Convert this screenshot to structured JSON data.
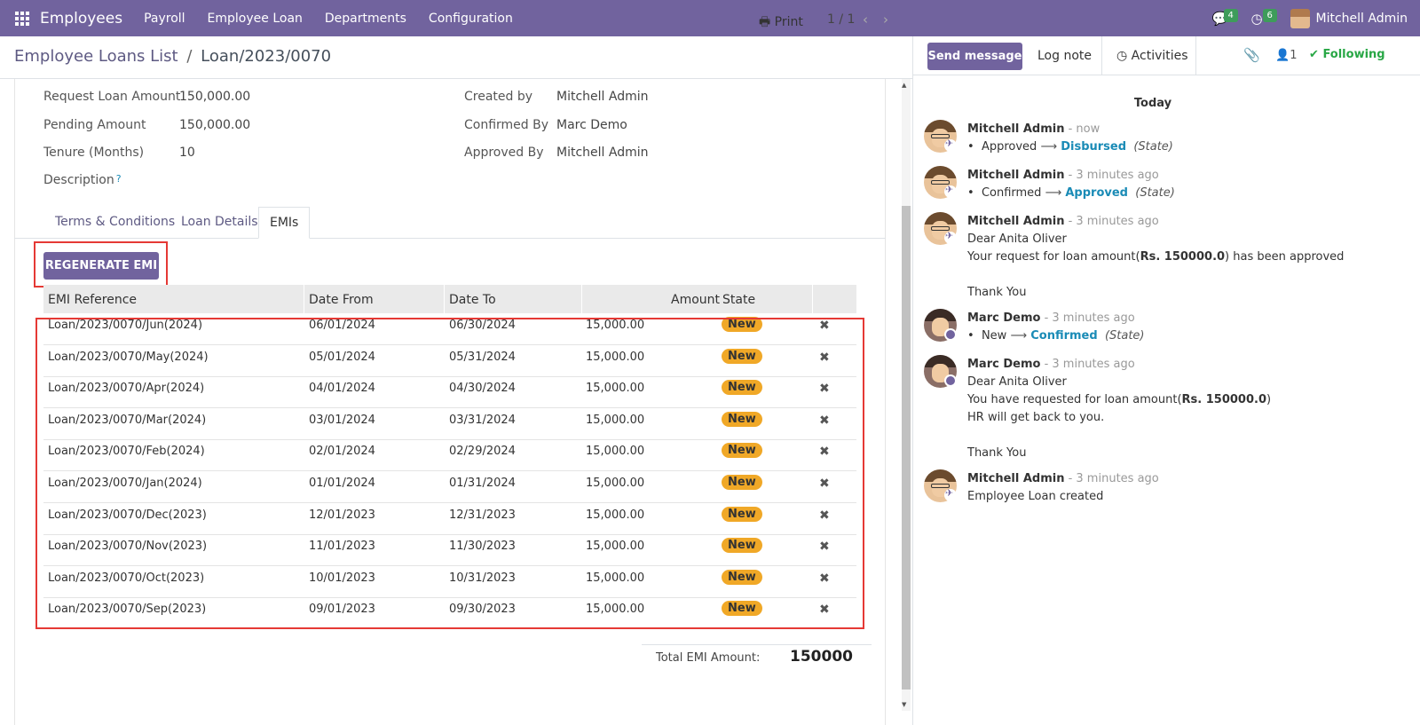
{
  "navbar": {
    "app_name": "Employees",
    "menu": [
      "Payroll",
      "Employee Loan",
      "Departments",
      "Configuration"
    ],
    "messages_count": "4",
    "activities_count": "6",
    "user_name": "Mitchell Admin"
  },
  "control": {
    "breadcrumb_parent": "Employee Loans List",
    "breadcrumb_sep": "/",
    "breadcrumb_current": "Loan/2023/0070",
    "print_label": "Print",
    "pager": "1 / 1"
  },
  "form": {
    "left_fields": [
      {
        "label": "Request Loan Amount",
        "value": "150,000.00"
      },
      {
        "label": "Pending Amount",
        "value": "150,000.00"
      },
      {
        "label": "Tenure (Months)",
        "value": "10"
      },
      {
        "label": "Description",
        "value": ""
      }
    ],
    "right_fields": [
      {
        "label": "Created by",
        "value": "Mitchell Admin"
      },
      {
        "label": "Confirmed By",
        "value": "Marc Demo"
      },
      {
        "label": "Approved By",
        "value": "Mitchell Admin"
      }
    ],
    "help_mark": "?",
    "tabs": [
      "Terms & Conditions",
      "Loan Details",
      "EMIs"
    ],
    "regenerate_label": "REGENERATE EMI",
    "columns": [
      "EMI Reference",
      "Date From",
      "Date To",
      "Amount",
      "State"
    ],
    "rows": [
      {
        "ref": "Loan/2023/0070/Jun(2024)",
        "from": "06/01/2024",
        "to": "06/30/2024",
        "amount": "15,000.00",
        "state": "New"
      },
      {
        "ref": "Loan/2023/0070/May(2024)",
        "from": "05/01/2024",
        "to": "05/31/2024",
        "amount": "15,000.00",
        "state": "New"
      },
      {
        "ref": "Loan/2023/0070/Apr(2024)",
        "from": "04/01/2024",
        "to": "04/30/2024",
        "amount": "15,000.00",
        "state": "New"
      },
      {
        "ref": "Loan/2023/0070/Mar(2024)",
        "from": "03/01/2024",
        "to": "03/31/2024",
        "amount": "15,000.00",
        "state": "New"
      },
      {
        "ref": "Loan/2023/0070/Feb(2024)",
        "from": "02/01/2024",
        "to": "02/29/2024",
        "amount": "15,000.00",
        "state": "New"
      },
      {
        "ref": "Loan/2023/0070/Jan(2024)",
        "from": "01/01/2024",
        "to": "01/31/2024",
        "amount": "15,000.00",
        "state": "New"
      },
      {
        "ref": "Loan/2023/0070/Dec(2023)",
        "from": "12/01/2023",
        "to": "12/31/2023",
        "amount": "15,000.00",
        "state": "New"
      },
      {
        "ref": "Loan/2023/0070/Nov(2023)",
        "from": "11/01/2023",
        "to": "11/30/2023",
        "amount": "15,000.00",
        "state": "New"
      },
      {
        "ref": "Loan/2023/0070/Oct(2023)",
        "from": "10/01/2023",
        "to": "10/31/2023",
        "amount": "15,000.00",
        "state": "New"
      },
      {
        "ref": "Loan/2023/0070/Sep(2023)",
        "from": "09/01/2023",
        "to": "09/30/2023",
        "amount": "15,000.00",
        "state": "New"
      }
    ],
    "total_label": "Total EMI Amount:",
    "total_value": "150000"
  },
  "chatter": {
    "send_message": "Send message",
    "log_note": "Log note",
    "activities": "Activities",
    "followers_count": "1",
    "following": "Following",
    "day_label": "Today",
    "messages": [
      {
        "author": "Mitchell Admin",
        "time": " - now",
        "old": "Approved",
        "new": "Disbursed",
        "field": "(State)"
      },
      {
        "author": "Mitchell Admin",
        "time": " - 3 minutes ago",
        "old": "Confirmed",
        "new": "Approved",
        "field": "(State)"
      },
      {
        "author": "Mitchell Admin",
        "time": " - 3 minutes ago",
        "line1": "Dear Anita Oliver",
        "line2_a": "Your request for loan amount(",
        "line2_b": "Rs. 150000.0",
        "line2_c": ") has been approved",
        "line3": "Thank You"
      },
      {
        "author": "Marc Demo",
        "time": " - 3 minutes ago",
        "old": "New",
        "new": "Confirmed",
        "field": "(State)"
      },
      {
        "author": "Marc Demo",
        "time": " - 3 minutes ago",
        "line1": "Dear Anita Oliver",
        "line2_a": "You have requested for loan amount(",
        "line2_b": "Rs. 150000.0",
        "line2_c": ")",
        "line3": "HR will get back to you.",
        "line4": "Thank You"
      },
      {
        "author": "Mitchell Admin",
        "time": " - 3 minutes ago",
        "line1": "Employee Loan created"
      }
    ]
  },
  "colors": {
    "brand": "#71639e",
    "badge": "#f0a827",
    "highlight": "#e53935",
    "following": "#28a745",
    "link": "#1a8bb6"
  }
}
